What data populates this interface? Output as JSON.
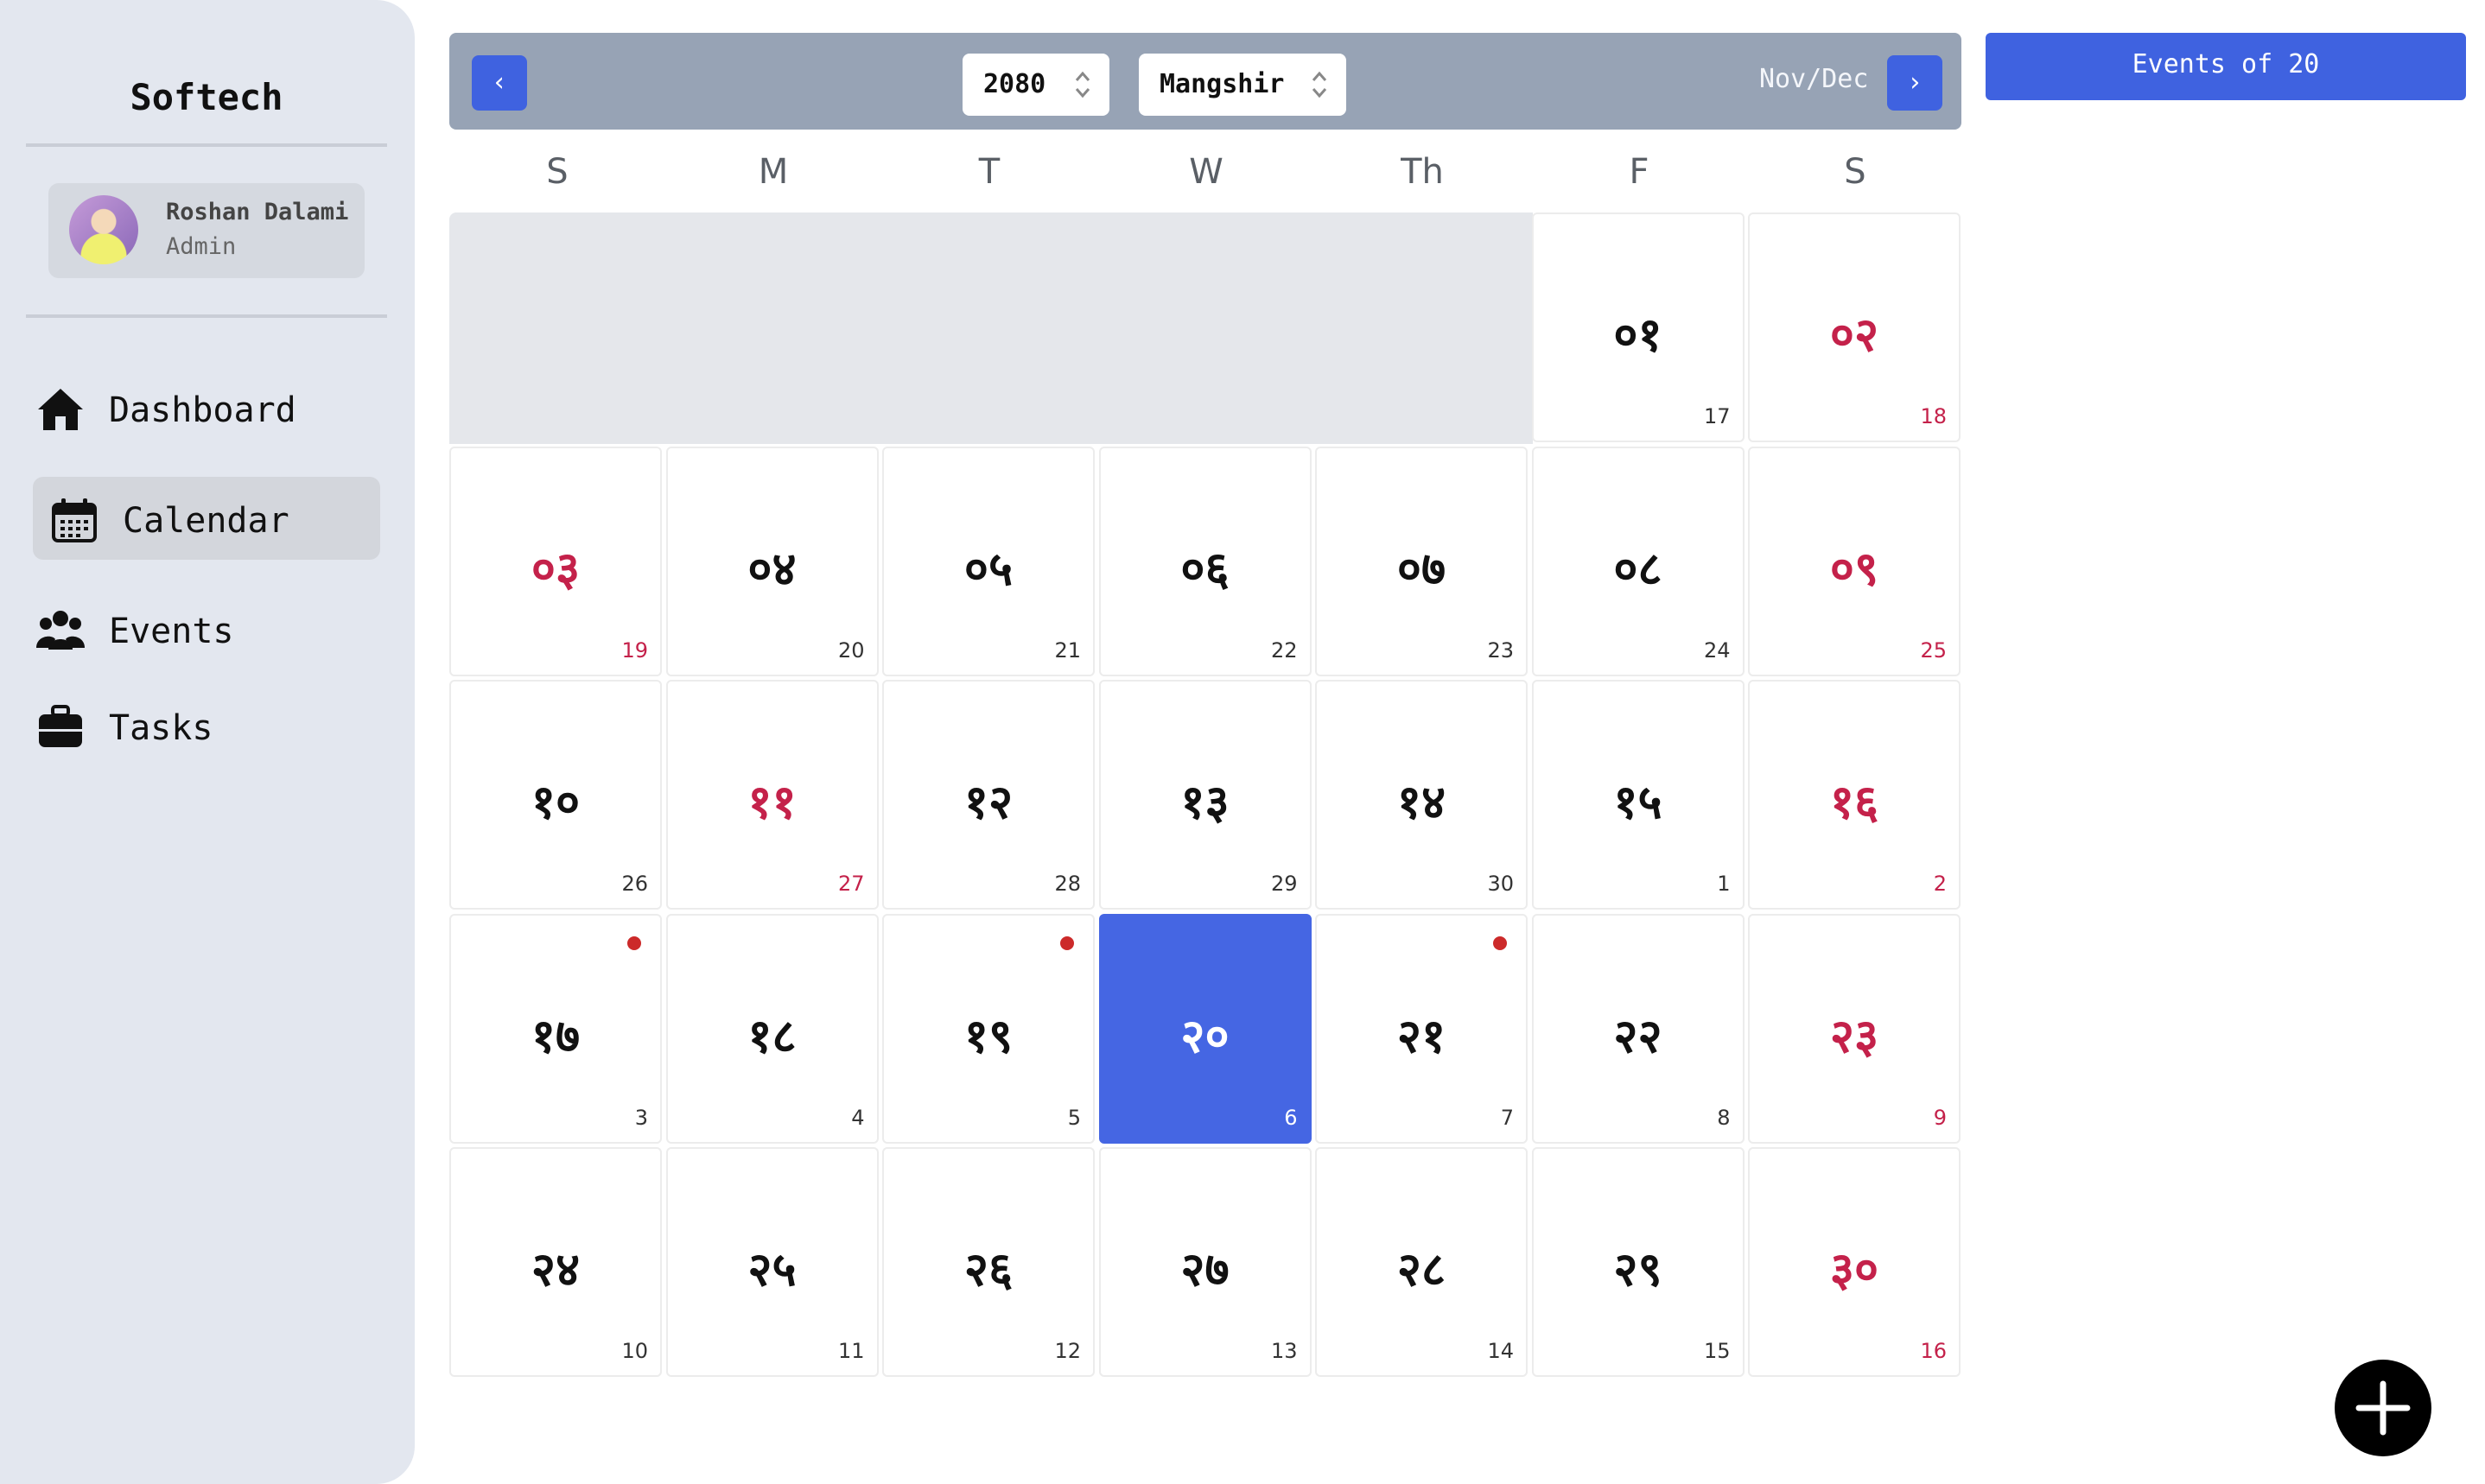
{
  "sidebar": {
    "brand": "Softech",
    "profile": {
      "name": "Roshan Dalami",
      "role": "Admin"
    },
    "nav": [
      {
        "label": "Dashboard",
        "icon": "home-icon",
        "active": false
      },
      {
        "label": "Calendar",
        "icon": "calendar-icon",
        "active": true
      },
      {
        "label": "Events",
        "icon": "users-icon",
        "active": false
      },
      {
        "label": "Tasks",
        "icon": "briefcase-icon",
        "active": false
      }
    ]
  },
  "header": {
    "prev_label": "‹",
    "next_label": "›",
    "year": "2080",
    "month": "Mangshir",
    "month_range": "Nov/Dec"
  },
  "events_panel": {
    "label": "Events of 20"
  },
  "calendar": {
    "weekdays": [
      "S",
      "M",
      "T",
      "W",
      "Th",
      "F",
      "S"
    ],
    "leading_blank": 5,
    "days": [
      {
        "np": "०१",
        "ad": "17"
      },
      {
        "np": "०२",
        "ad": "18"
      },
      {
        "np": "०३",
        "ad": "19",
        "holiday": true
      },
      {
        "np": "०४",
        "ad": "20"
      },
      {
        "np": "०५",
        "ad": "21"
      },
      {
        "np": "०६",
        "ad": "22"
      },
      {
        "np": "०७",
        "ad": "23"
      },
      {
        "np": "०८",
        "ad": "24"
      },
      {
        "np": "०९",
        "ad": "25"
      },
      {
        "np": "१०",
        "ad": "26"
      },
      {
        "np": "११",
        "ad": "27",
        "holiday": true
      },
      {
        "np": "१२",
        "ad": "28"
      },
      {
        "np": "१३",
        "ad": "29"
      },
      {
        "np": "१४",
        "ad": "30"
      },
      {
        "np": "१५",
        "ad": "1"
      },
      {
        "np": "१६",
        "ad": "2"
      },
      {
        "np": "१७",
        "ad": "3",
        "event": true
      },
      {
        "np": "१८",
        "ad": "4"
      },
      {
        "np": "१९",
        "ad": "5",
        "event": true
      },
      {
        "np": "२०",
        "ad": "6",
        "today": true
      },
      {
        "np": "२१",
        "ad": "7",
        "event": true
      },
      {
        "np": "२२",
        "ad": "8"
      },
      {
        "np": "२३",
        "ad": "9"
      },
      {
        "np": "२४",
        "ad": "10"
      },
      {
        "np": "२५",
        "ad": "11"
      },
      {
        "np": "२६",
        "ad": "12"
      },
      {
        "np": "२७",
        "ad": "13"
      },
      {
        "np": "२८",
        "ad": "14"
      },
      {
        "np": "२९",
        "ad": "15"
      },
      {
        "np": "३०",
        "ad": "16"
      }
    ]
  },
  "fab": {
    "icon": "plus-icon"
  },
  "colors": {
    "accent": "#3f62e0",
    "holiday": "#c4214a",
    "event_dot": "#cc2a2a",
    "header_bg": "#97a3b5"
  }
}
